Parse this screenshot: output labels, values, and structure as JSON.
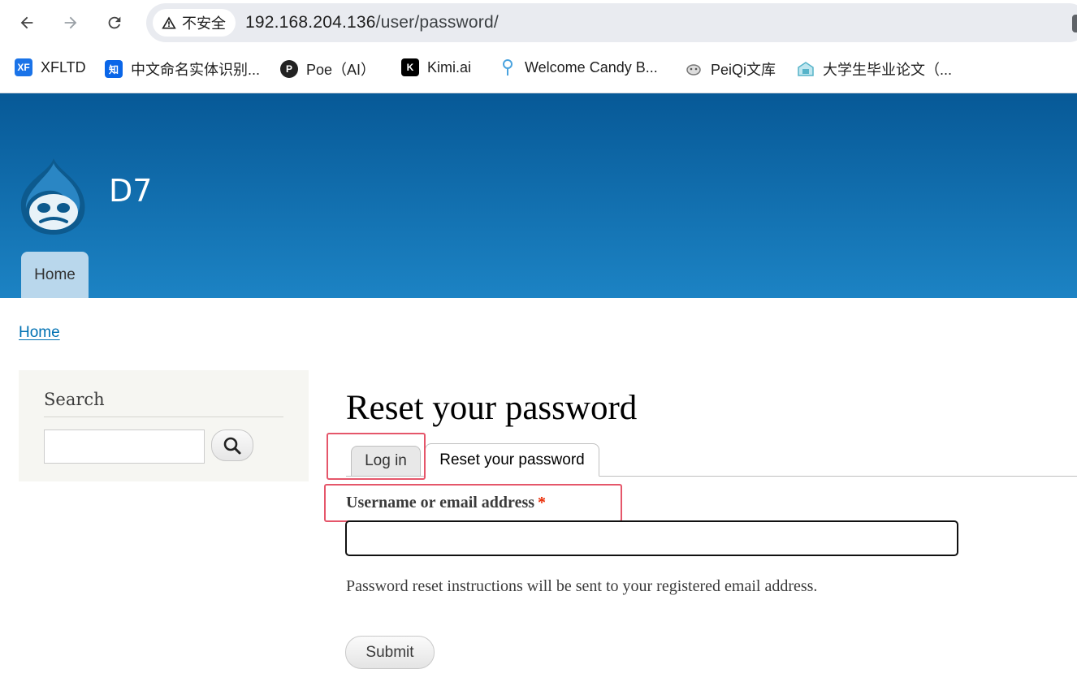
{
  "browser": {
    "security_label": "不安全",
    "url_host": "192.168.204.136",
    "url_path": "/user/password/",
    "translate_icon_text": "G"
  },
  "bookmarks": [
    {
      "label": "XFLTD",
      "icon": "xfltd-icon",
      "icon_text": "XF",
      "color": "#1a73e8"
    },
    {
      "label": "中文命名实体识别...",
      "icon": "zhihu-icon",
      "icon_text": "知",
      "color": "#0a66e8"
    },
    {
      "label": "Poe（AI）",
      "icon": "poe-icon",
      "icon_text": "P",
      "color": "#222222"
    },
    {
      "label": "Kimi.ai",
      "icon": "kimi-icon",
      "icon_text": "K",
      "color": "#000000"
    },
    {
      "label": "Welcome Candy B...",
      "icon": "candy-icon",
      "icon_text": "",
      "color": "#4aa3df"
    },
    {
      "label": "PeiQi文库",
      "icon": "peiqi-icon",
      "icon_text": "",
      "color": "#888888"
    },
    {
      "label": "大学生毕业论文（...",
      "icon": "thesis-icon",
      "icon_text": "",
      "color": "#56b3c9"
    }
  ],
  "site": {
    "name": "D7",
    "home_tab": "Home"
  },
  "breadcrumb": "Home",
  "sidebar": {
    "search_title": "Search",
    "search_value": ""
  },
  "main": {
    "title": "Reset your password",
    "tabs": [
      "Log in",
      "Reset your password"
    ],
    "field_label": "Username or email address",
    "required_marker": "*",
    "field_value": "",
    "description": "Password reset instructions will be sent to your registered email address.",
    "submit_label": "Submit"
  },
  "colors": {
    "header_top": "#075997",
    "header_bottom": "#1c83c4",
    "link": "#0071b3",
    "highlight": "#e5566a",
    "required": "#ea2800"
  }
}
